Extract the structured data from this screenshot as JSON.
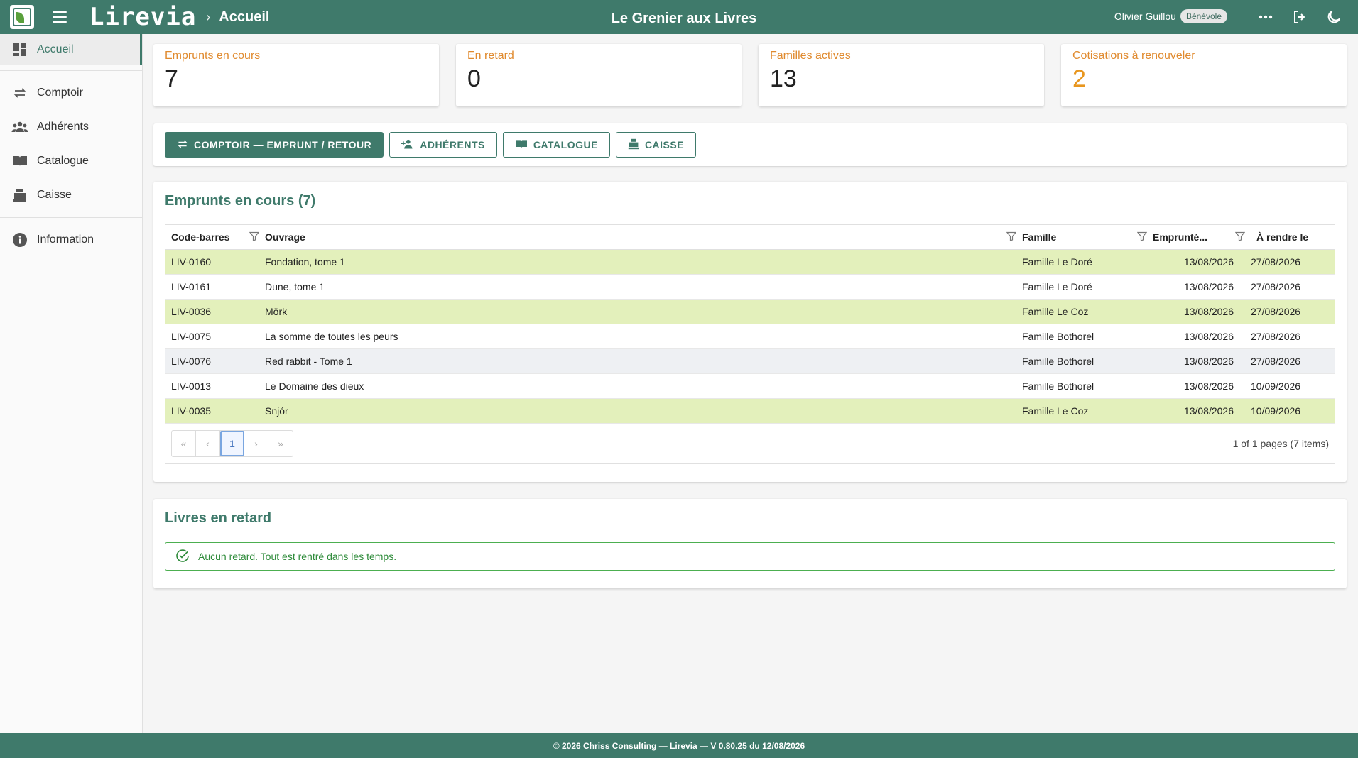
{
  "header": {
    "brand": "Lirevia",
    "breadcrumb": "Accueil",
    "org_title": "Le Grenier aux Livres",
    "user_name": "Olivier Guillou",
    "user_role": "Bénévole"
  },
  "sidebar": {
    "items": [
      {
        "label": "Accueil",
        "icon": "dashboard-icon"
      },
      {
        "label": "Comptoir",
        "icon": "swap-icon"
      },
      {
        "label": "Adhérents",
        "icon": "people-icon"
      },
      {
        "label": "Catalogue",
        "icon": "book-icon"
      },
      {
        "label": "Caisse",
        "icon": "cash-register-icon"
      },
      {
        "label": "Information",
        "icon": "info-icon"
      }
    ]
  },
  "stats": [
    {
      "label": "Emprunts en cours",
      "value": "7"
    },
    {
      "label": "En retard",
      "value": "0"
    },
    {
      "label": "Familles actives",
      "value": "13"
    },
    {
      "label": "Cotisations à renouveler",
      "value": "2"
    }
  ],
  "actions": {
    "counter": "COMPTOIR — EMPRUNT / RETOUR",
    "members": "ADHÉRENTS",
    "catalogue": "CATALOGUE",
    "cash": "CAISSE"
  },
  "loans": {
    "title": "Emprunts en cours (7)",
    "columns": [
      "Code-barres",
      "Ouvrage",
      "Famille",
      "Emprunté...",
      "À rendre le"
    ],
    "rows": [
      {
        "code": "LIV-0160",
        "title": "Fondation, tome 1",
        "family": "Famille Le Doré",
        "borrowed": "13/08/2026",
        "due": "27/08/2026"
      },
      {
        "code": "LIV-0161",
        "title": "Dune, tome 1",
        "family": "Famille Le Doré",
        "borrowed": "13/08/2026",
        "due": "27/08/2026"
      },
      {
        "code": "LIV-0036",
        "title": "Mörk",
        "family": "Famille Le Coz",
        "borrowed": "13/08/2026",
        "due": "27/08/2026"
      },
      {
        "code": "LIV-0075",
        "title": "La somme de toutes les peurs",
        "family": "Famille Bothorel",
        "borrowed": "13/08/2026",
        "due": "27/08/2026"
      },
      {
        "code": "LIV-0076",
        "title": "Red rabbit - Tome 1",
        "family": "Famille Bothorel",
        "borrowed": "13/08/2026",
        "due": "27/08/2026"
      },
      {
        "code": "LIV-0013",
        "title": "Le Domaine des dieux",
        "family": "Famille Bothorel",
        "borrowed": "13/08/2026",
        "due": "10/09/2026"
      },
      {
        "code": "LIV-0035",
        "title": "Snjór",
        "family": "Famille Le Coz",
        "borrowed": "13/08/2026",
        "due": "10/09/2026"
      }
    ],
    "pager": {
      "first": "«",
      "prev": "‹",
      "current": "1",
      "next": "›",
      "last": "»",
      "info": "1 of 1 pages (7 items)"
    }
  },
  "late": {
    "title": "Livres en retard",
    "message": "Aucun retard. Tout est rentré dans les temps."
  },
  "footer": {
    "text": "© 2026 Chriss Consulting — Lirevia — V 0.80.25 du 12/08/2026"
  },
  "colors": {
    "primary": "#3f7a6b",
    "accent_orange": "#e08a2e",
    "highlight_row": "#e3f0bb",
    "success": "#4caf50"
  }
}
